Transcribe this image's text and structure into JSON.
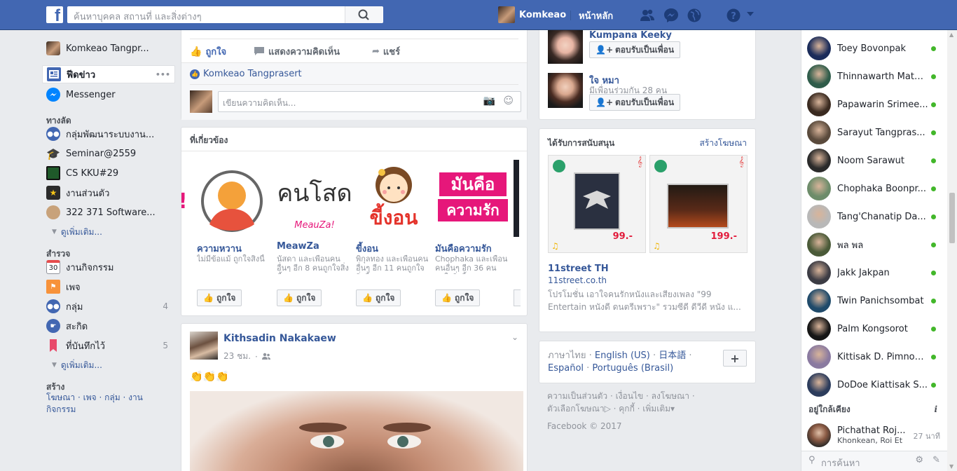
{
  "topbar": {
    "logo": "f",
    "search_placeholder": "ค้นหาบุคคล สถานที่ และสิ่งต่างๆ",
    "user_name": "Komkeao",
    "home_label": "หน้าหลัก"
  },
  "left": {
    "profile_name": "Komkeao Tangpr...",
    "news_feed": "ฟีดข่าว",
    "news_more": "•••",
    "messenger": "Messenger",
    "shortcuts_head": "ทางลัด",
    "shortcuts": [
      {
        "label": "กลุ่มพัฒนาระบบงาน..."
      },
      {
        "label": "Seminar@2559"
      },
      {
        "label": "CS KKU#29"
      },
      {
        "label": "งานส่วนตัว"
      },
      {
        "label": "322 371 Software..."
      }
    ],
    "see_more_1": "ดูเพิ่มเติม...",
    "explore_head": "สำรวจ",
    "explore": [
      {
        "label": "งานกิจกรรม",
        "count": "",
        "calendar_day": "30"
      },
      {
        "label": "เพจ",
        "count": ""
      },
      {
        "label": "กลุ่ม",
        "count": "4"
      },
      {
        "label": "สะกิด",
        "count": ""
      },
      {
        "label": "ที่บันทึกไว้",
        "count": "5"
      }
    ],
    "see_more_2": "ดูเพิ่มเติม...",
    "create_head": "สร้าง",
    "create_links": [
      "โฆษณา",
      "เพจ",
      "กลุ่ม",
      "งาน",
      "กิจกรรม"
    ]
  },
  "post1": {
    "like": "ถูกใจ",
    "comment": "แสดงความคิดเห็น",
    "share": "แชร์",
    "liker": "Komkeao Tangprasert",
    "comment_placeholder": "เขียนความคิดเห็น..."
  },
  "related": {
    "title": "ที่เกี่ยวข้อง",
    "items": [
      {
        "name": "ความหวาน",
        "desc": "ไม่มีข้อแม้ ถูกใจสิ่งนี้",
        "like": "ถูกใจ"
      },
      {
        "name": "MeawZa",
        "desc": "นัสดา และเพื่อนคนอื่นๆ อีก 8 คนถูกใจสิ่งนี้",
        "like": "ถูกใจ",
        "logo_text": "คนโสด",
        "logo_sub": "MeauZa!"
      },
      {
        "name": "ขี้งอน",
        "desc": "พิกุลทอง และเพื่อนคนอื่นๆ อีก 11 คนถูกใจสิ่งนี้",
        "like": "ถูกใจ",
        "logo_text": "ขี้งอน"
      },
      {
        "name": "มันคือความรัก",
        "desc": "Chophaka และเพื่อนคนอื่นๆ อีก 36 คนถูกใจสิ่งนี้",
        "like": "ถูกใจ",
        "logo_top": "มันคือ",
        "logo_bottom": "ความรัก"
      }
    ]
  },
  "post2": {
    "author": "Kithsadin Nakakaew",
    "time": "23 ชม.",
    "body": "👏👏👏"
  },
  "suggest": {
    "people": [
      {
        "name": "Kumpana Keeky",
        "sub": "",
        "button": "ตอบรับเป็นเพื่อน"
      },
      {
        "name": "ใจ หมา",
        "sub": "มีเพื่อนร่วมกัน 28 คน",
        "button": "ตอบรับเป็นเพื่อน"
      }
    ]
  },
  "sponsored": {
    "title": "ได้รับการสนับสนุน",
    "create_ad": "สร้างโฆษณา",
    "prices": [
      "99.-",
      "199.-"
    ],
    "advertiser": "11street TH",
    "url": "11street.co.th",
    "desc": "โปรโมชั่น เอาใจคนรักหนังและเสียงเพลง \"99 Entertain หนังดี ดนตรีเพราะ\" รวมซีดี ดีวีดี หนัง แ..."
  },
  "languages": {
    "current": "ภาษาไทย",
    "links": [
      "English (US)",
      "日本語",
      "Español",
      "Português (Brasil)"
    ],
    "plus": "+"
  },
  "footer": {
    "links": [
      "ความเป็นส่วนตัว",
      "เงื่อนไข",
      "ลงโฆษณา",
      "ตัวเลือกโฆษณา",
      "คุกกี้",
      "เพิ่มเติม"
    ],
    "copyright": "Facebook © 2017"
  },
  "chat": {
    "contacts": [
      {
        "name": "Toey Bovonpak"
      },
      {
        "name": "Thinnawarth Math..."
      },
      {
        "name": "Papawarin Srimee..."
      },
      {
        "name": "Sarayut Tangpras..."
      },
      {
        "name": "Noom Sarawut"
      },
      {
        "name": "Chophaka Boonpr..."
      },
      {
        "name": "Tang'Chanatip Da..."
      },
      {
        "name": "พล พล"
      },
      {
        "name": "Jakk Jakpan"
      },
      {
        "name": "Twin Panichsombat"
      },
      {
        "name": "Palm Kongsorot"
      },
      {
        "name": "Kittisak D. Pimnon..."
      },
      {
        "name": "DoDoe Kiattisak S..."
      }
    ],
    "nearby_head": "อยู่ใกล้เคียง",
    "nearby_info": "i",
    "nearby": {
      "name": "Pichathat Roj...",
      "location": "Khonkean, Roi Et",
      "time": "27 นาที"
    },
    "search_placeholder": "การค้นหา"
  }
}
